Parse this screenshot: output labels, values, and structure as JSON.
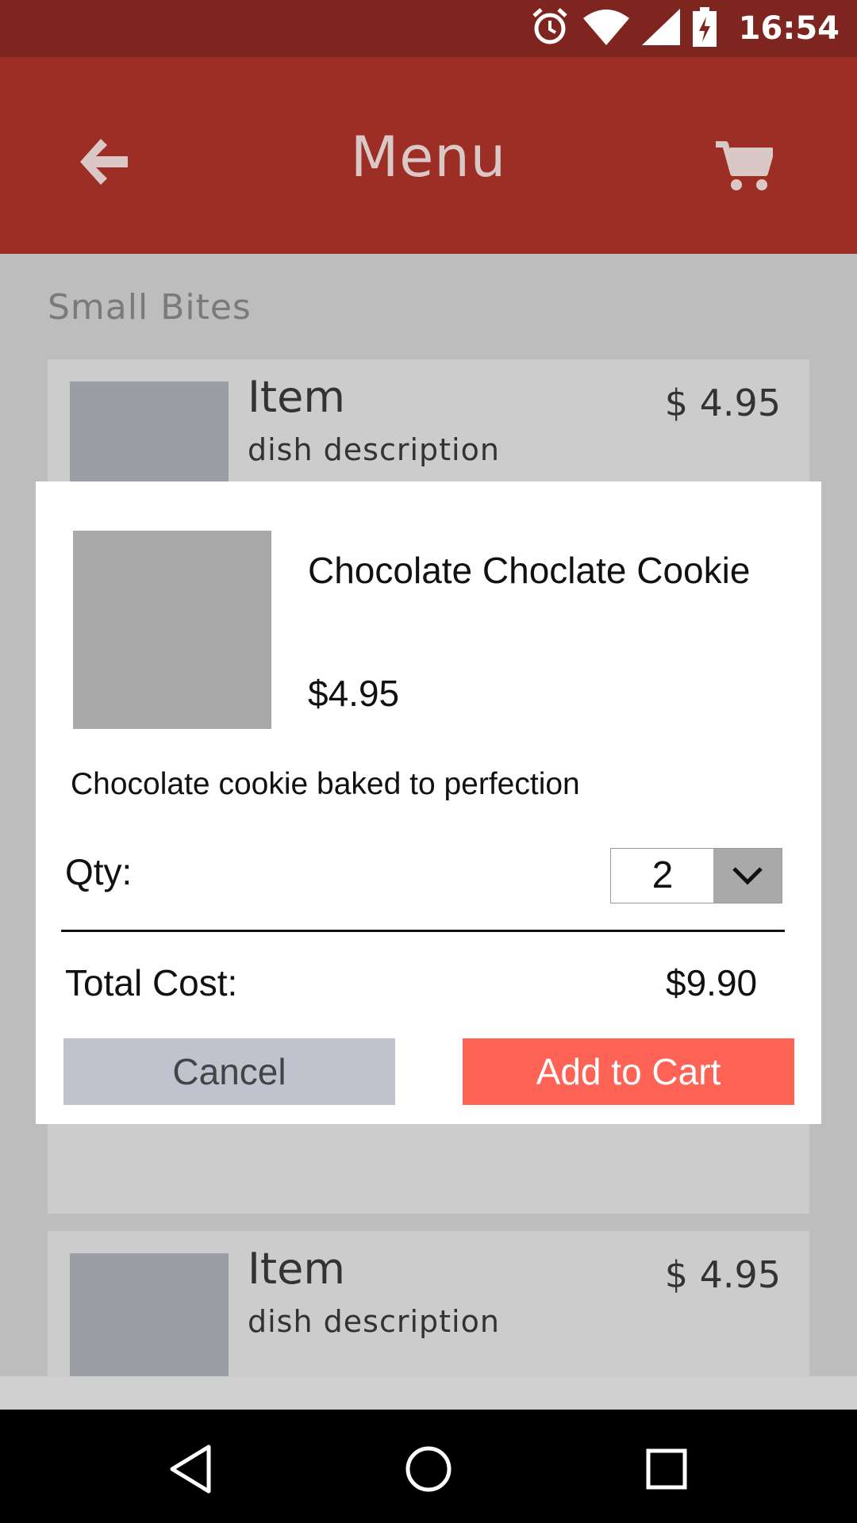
{
  "status_bar": {
    "time": "16:54",
    "icons": [
      "alarm-icon",
      "wifi-icon",
      "signal-icon",
      "battery-charging-icon"
    ]
  },
  "app_bar": {
    "title": "Menu",
    "back_icon": "back-arrow-icon",
    "cart_icon": "cart-icon"
  },
  "section": {
    "title": "Small Bites"
  },
  "menu_items": [
    {
      "name": "Item",
      "description": "dish description",
      "price": "$ 4.95"
    },
    {
      "name": "Item",
      "description": "dish description",
      "price": "$ 4.95"
    }
  ],
  "dialog": {
    "item_name": "Chocolate Choclate Cookie",
    "price": "$4.95",
    "description": "Chocolate cookie baked to perfection",
    "qty_label": "Qty:",
    "qty_value": "2",
    "total_label": "Total Cost:",
    "total_value": "$9.90",
    "cancel_label": "Cancel",
    "add_label": "Add to Cart"
  },
  "colors": {
    "status_bar": "#7f2520",
    "app_bar": "#9d2e25",
    "add_button": "#ff6356",
    "cancel_button": "#c0c2ce"
  },
  "nav": {
    "icons": [
      "back-triangle-icon",
      "home-circle-icon",
      "recents-square-icon"
    ]
  }
}
